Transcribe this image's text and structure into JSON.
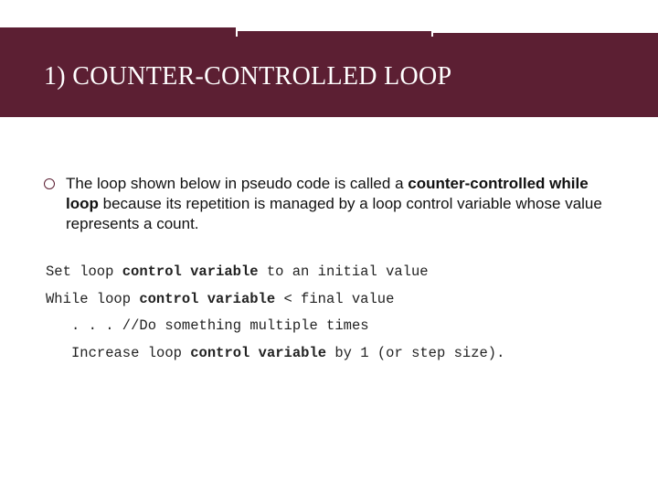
{
  "title": "1)  COUNTER-CONTROLLED LOOP",
  "bullet": {
    "pre": "The loop shown below in pseudo code is called a ",
    "bold": "counter-controlled while loop",
    "post": " because its repetition is managed by a loop control variable whose value represents a count."
  },
  "code": {
    "l1a": "Set loop ",
    "l1b": "control variable",
    "l1c": " to an initial value",
    "l2a": "While loop ",
    "l2b": "control variable",
    "l2c": " < final value",
    "l3": ". . . //Do something multiple times",
    "l4a": "Increase loop ",
    "l4b": "control variable",
    "l4c": " by 1 (or step size)."
  }
}
